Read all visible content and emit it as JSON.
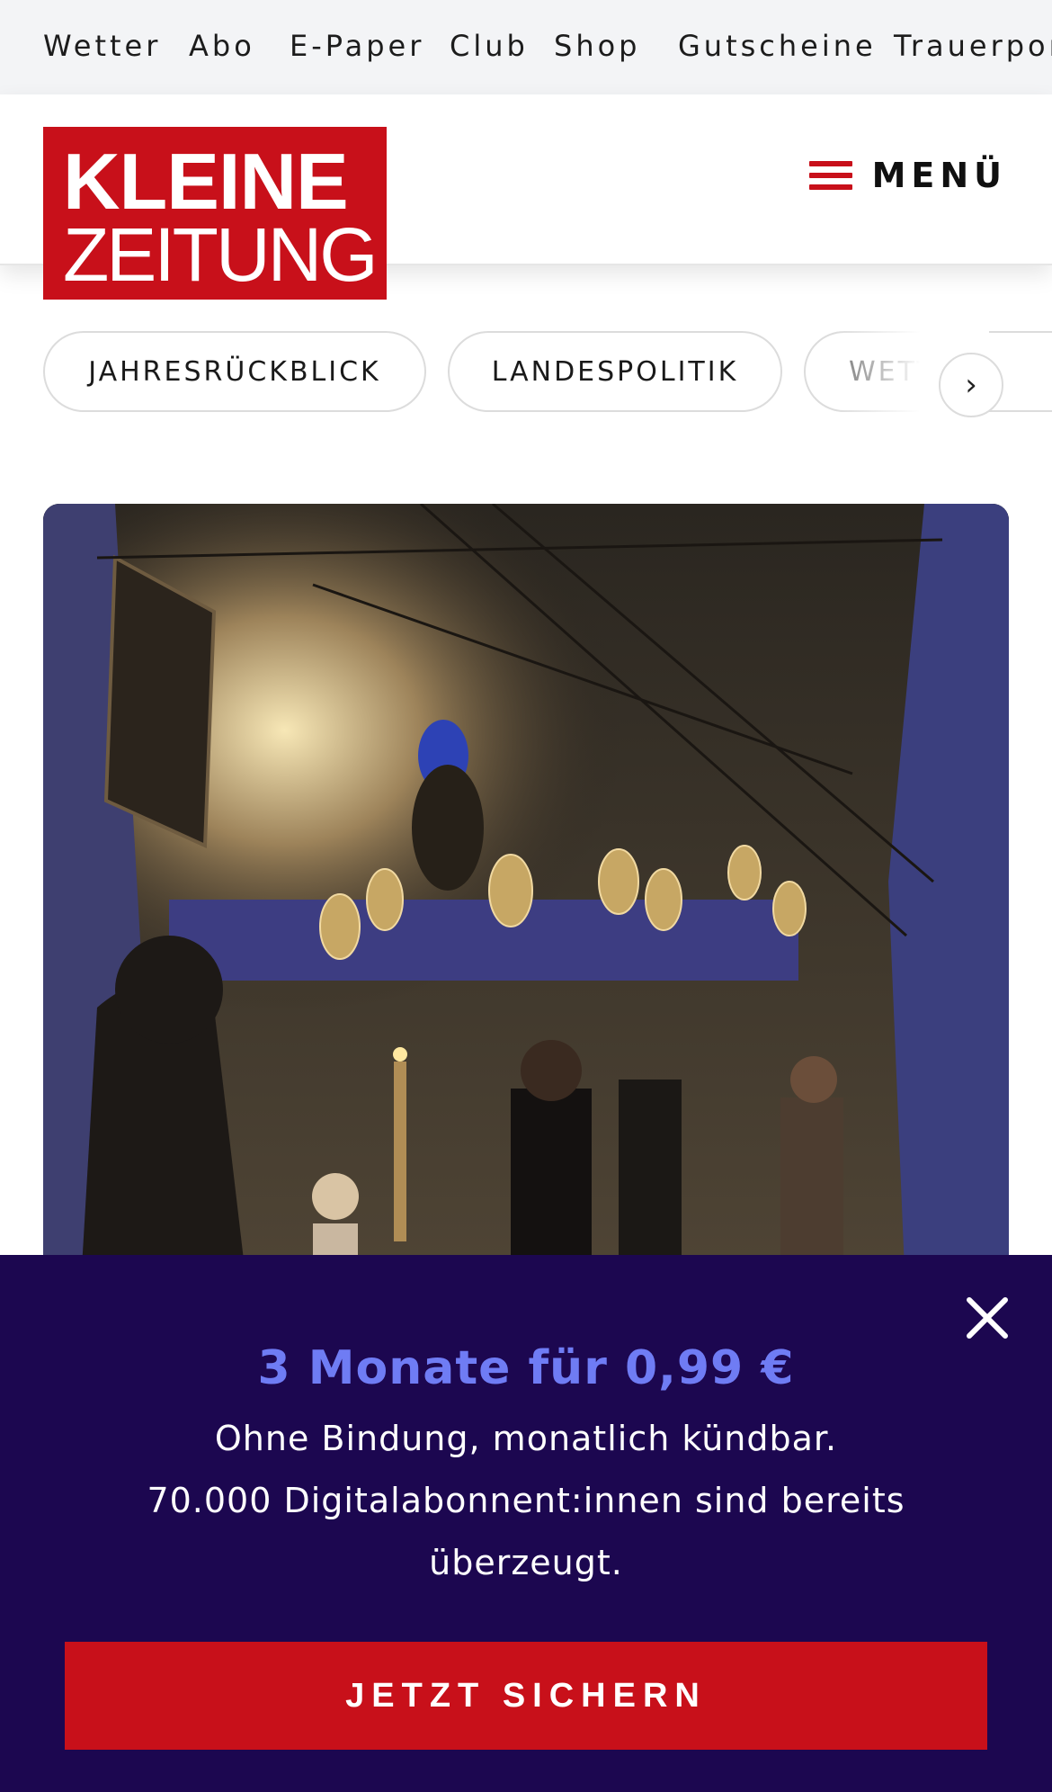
{
  "topnav": {
    "items": [
      "Wetter",
      "Abo",
      "E-Paper",
      "Club",
      "Shop",
      "Gutscheine",
      "Trauerportal"
    ]
  },
  "header": {
    "logo_line1": "KLEINE",
    "logo_line2": "ZEITUNG",
    "menu_label": "MENÜ"
  },
  "chips": {
    "items": [
      "JAHRESRÜCKBLICK",
      "LANDESPOLITIK",
      "WETTER"
    ]
  },
  "hero": {
    "image": "photo of a candle-lit grotto with hanging lamps and people gathered"
  },
  "banner": {
    "title": "3 Monate für 0,99 €",
    "line1": "Ohne Bindung, monatlich kündbar.",
    "line2": "70.000 Digitalabonnent:innen sind bereits überzeugt.",
    "cta_label": "JETZT SICHERN"
  },
  "colors": {
    "brand_red": "#c8101a",
    "banner_bg": "#1c0750",
    "banner_title": "#6f7cf4"
  }
}
